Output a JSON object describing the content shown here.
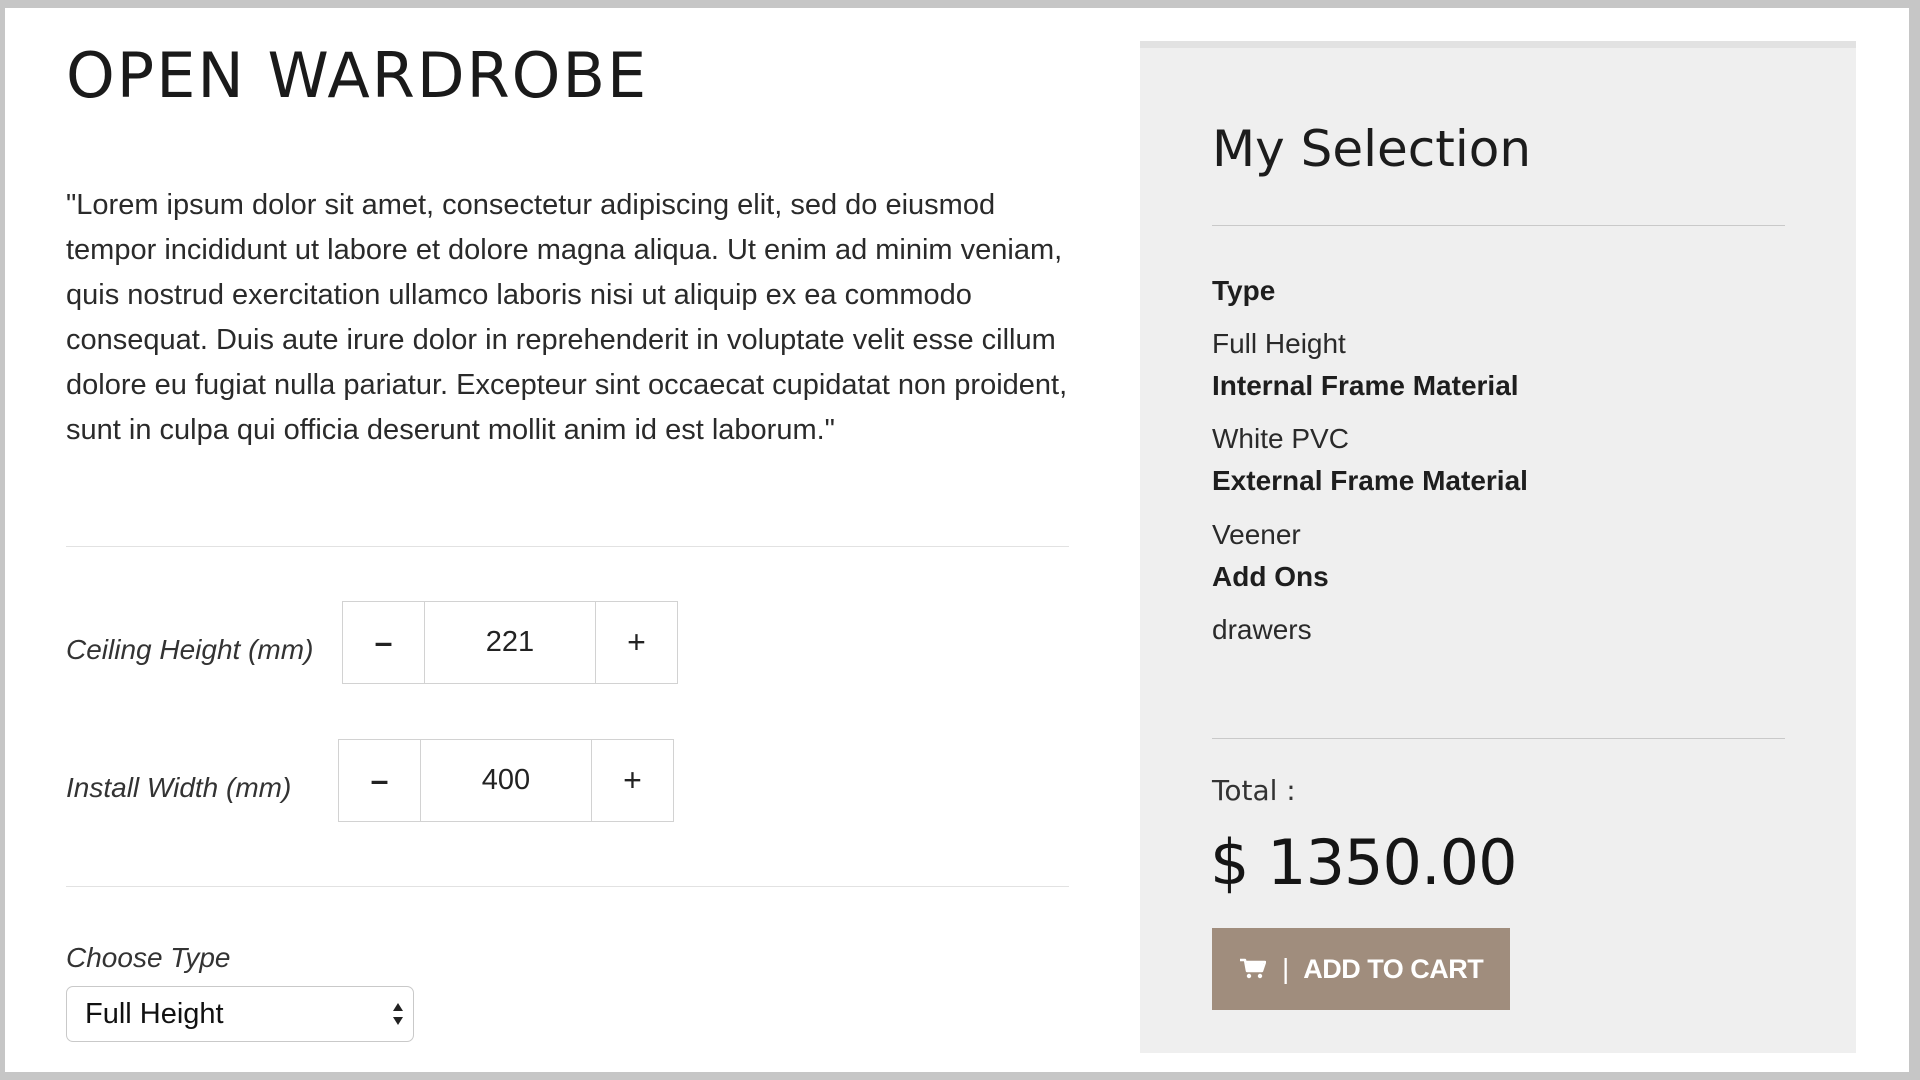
{
  "product": {
    "title": "OPEN WARDROBE",
    "description": "\"Lorem ipsum dolor sit amet, consectetur adipiscing elit, sed do eiusmod tempor incididunt ut labore et dolore magna aliqua. Ut enim ad minim veniam, quis nostrud exercitation ullamco laboris nisi ut aliquip ex ea commodo consequat. Duis aute irure dolor in reprehenderit in voluptate velit esse cillum dolore eu fugiat nulla pariatur. Excepteur sint occaecat cupidatat non proident, sunt in culpa qui officia deserunt mollit anim id est laborum.\""
  },
  "ceiling_height": {
    "label": "Ceiling Height (mm)",
    "value": "221",
    "minus": "–",
    "plus": "+"
  },
  "install_width": {
    "label": "Install Width (mm)",
    "value": "400",
    "minus": "–",
    "plus": "+"
  },
  "choose_type": {
    "label": "Choose Type",
    "selected": "Full Height"
  },
  "selection": {
    "title": "My Selection",
    "specs": [
      {
        "label": "Type",
        "value": "Full Height"
      },
      {
        "label": "Internal Frame Material",
        "value": "White PVC"
      },
      {
        "label": "External Frame Material",
        "value": "Veener"
      },
      {
        "label": "Add Ons",
        "value": "drawers"
      }
    ],
    "total_label": "Total :",
    "total_price": "$ 1350.00",
    "cart_separator": "|",
    "add_to_cart_label": "ADD TO CART",
    "cart_icon": "cart-icon",
    "button_color": "#a08d7d"
  }
}
